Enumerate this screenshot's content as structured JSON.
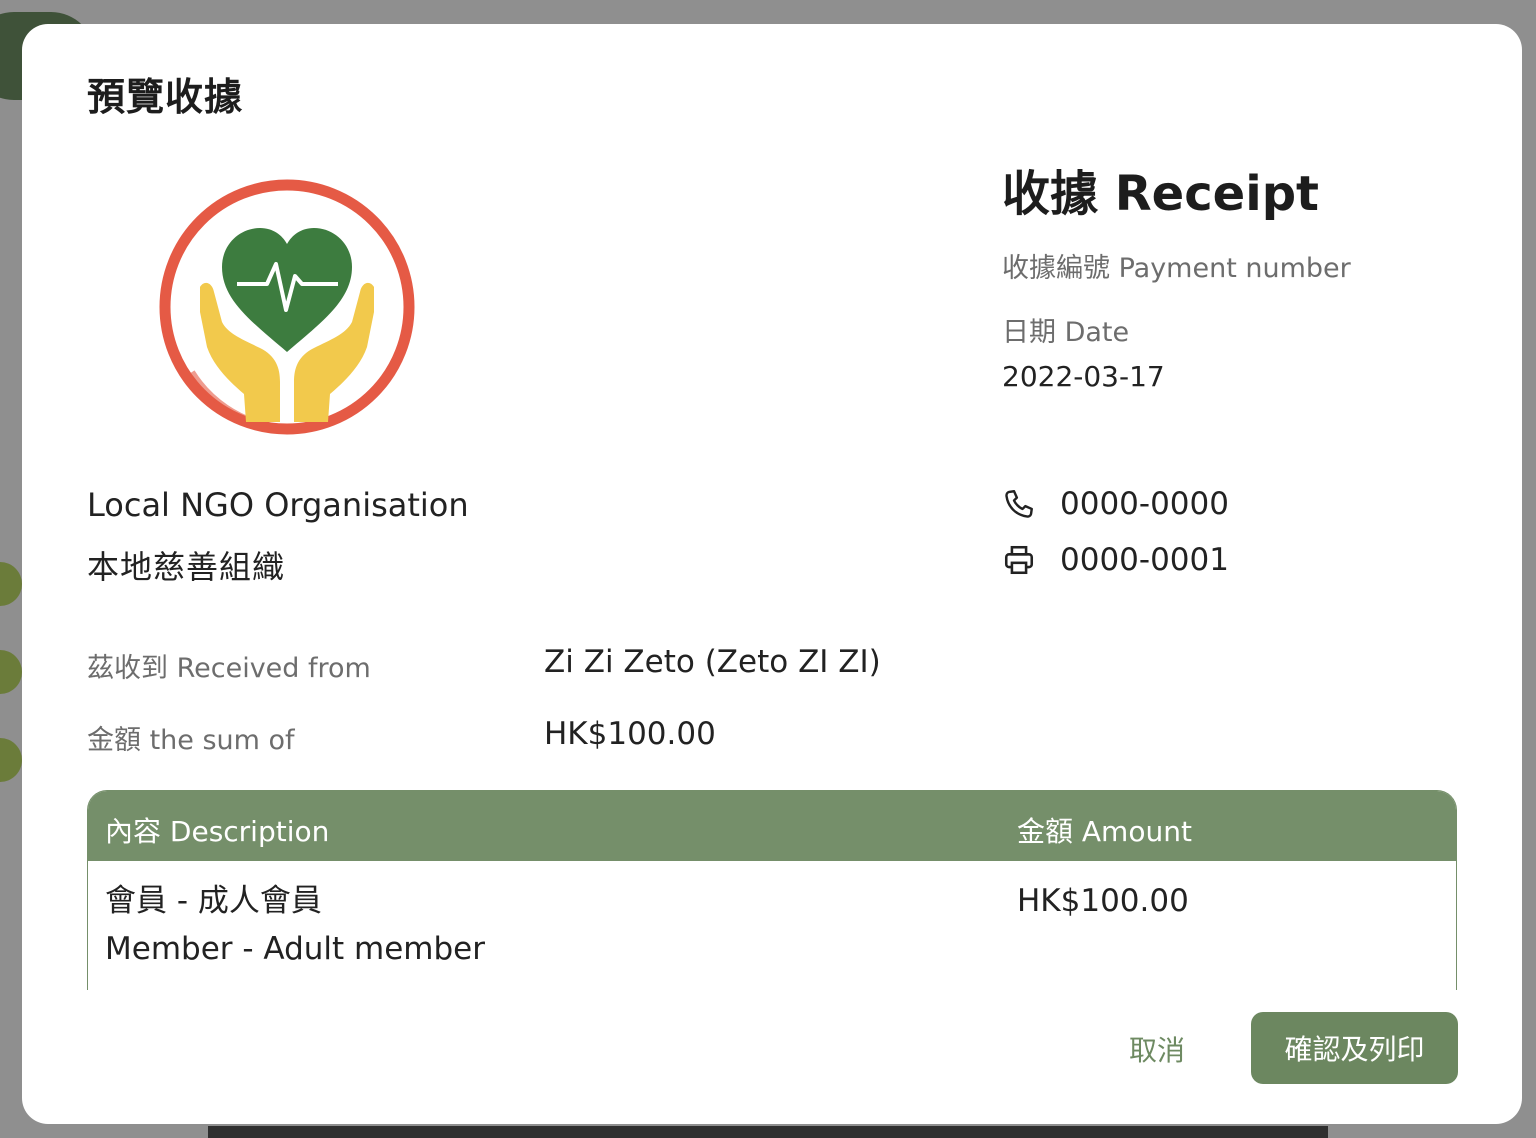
{
  "modal": {
    "title": "預覽收據"
  },
  "organisation": {
    "name_en": "Local NGO Organisation",
    "name_zh": "本地慈善組織",
    "logo_icon": "heart-hands-logo"
  },
  "receipt": {
    "title": "收據 Receipt",
    "payment_number_label": "收據編號 Payment number",
    "payment_number_value": "",
    "date_label": "日期 Date",
    "date_value": "2022-03-17"
  },
  "contact": {
    "phone": "0000-0000",
    "phone_icon": "phone-icon",
    "fax": "0000-0001",
    "fax_icon": "printer-icon"
  },
  "details": {
    "received_from_label": "茲收到 Received from",
    "received_from_value": "Zi Zi Zeto (Zeto ZI ZI)",
    "sum_label": "金額 the sum of",
    "sum_value": "HK$100.00"
  },
  "table": {
    "headers": {
      "description": "內容 Description",
      "amount": "金額 Amount"
    },
    "rows": [
      {
        "description_line1": "會員 - 成人會員",
        "description_line2": "Member - Adult member",
        "amount": "HK$100.00"
      }
    ]
  },
  "actions": {
    "cancel_label": "取消",
    "confirm_label": "確認及列印"
  },
  "colors": {
    "accent": "#6c8760",
    "table_header": "#758f6a",
    "logo_ring": "#e55a45",
    "logo_heart": "#3d7c3f",
    "logo_hands": "#f2c94c"
  }
}
